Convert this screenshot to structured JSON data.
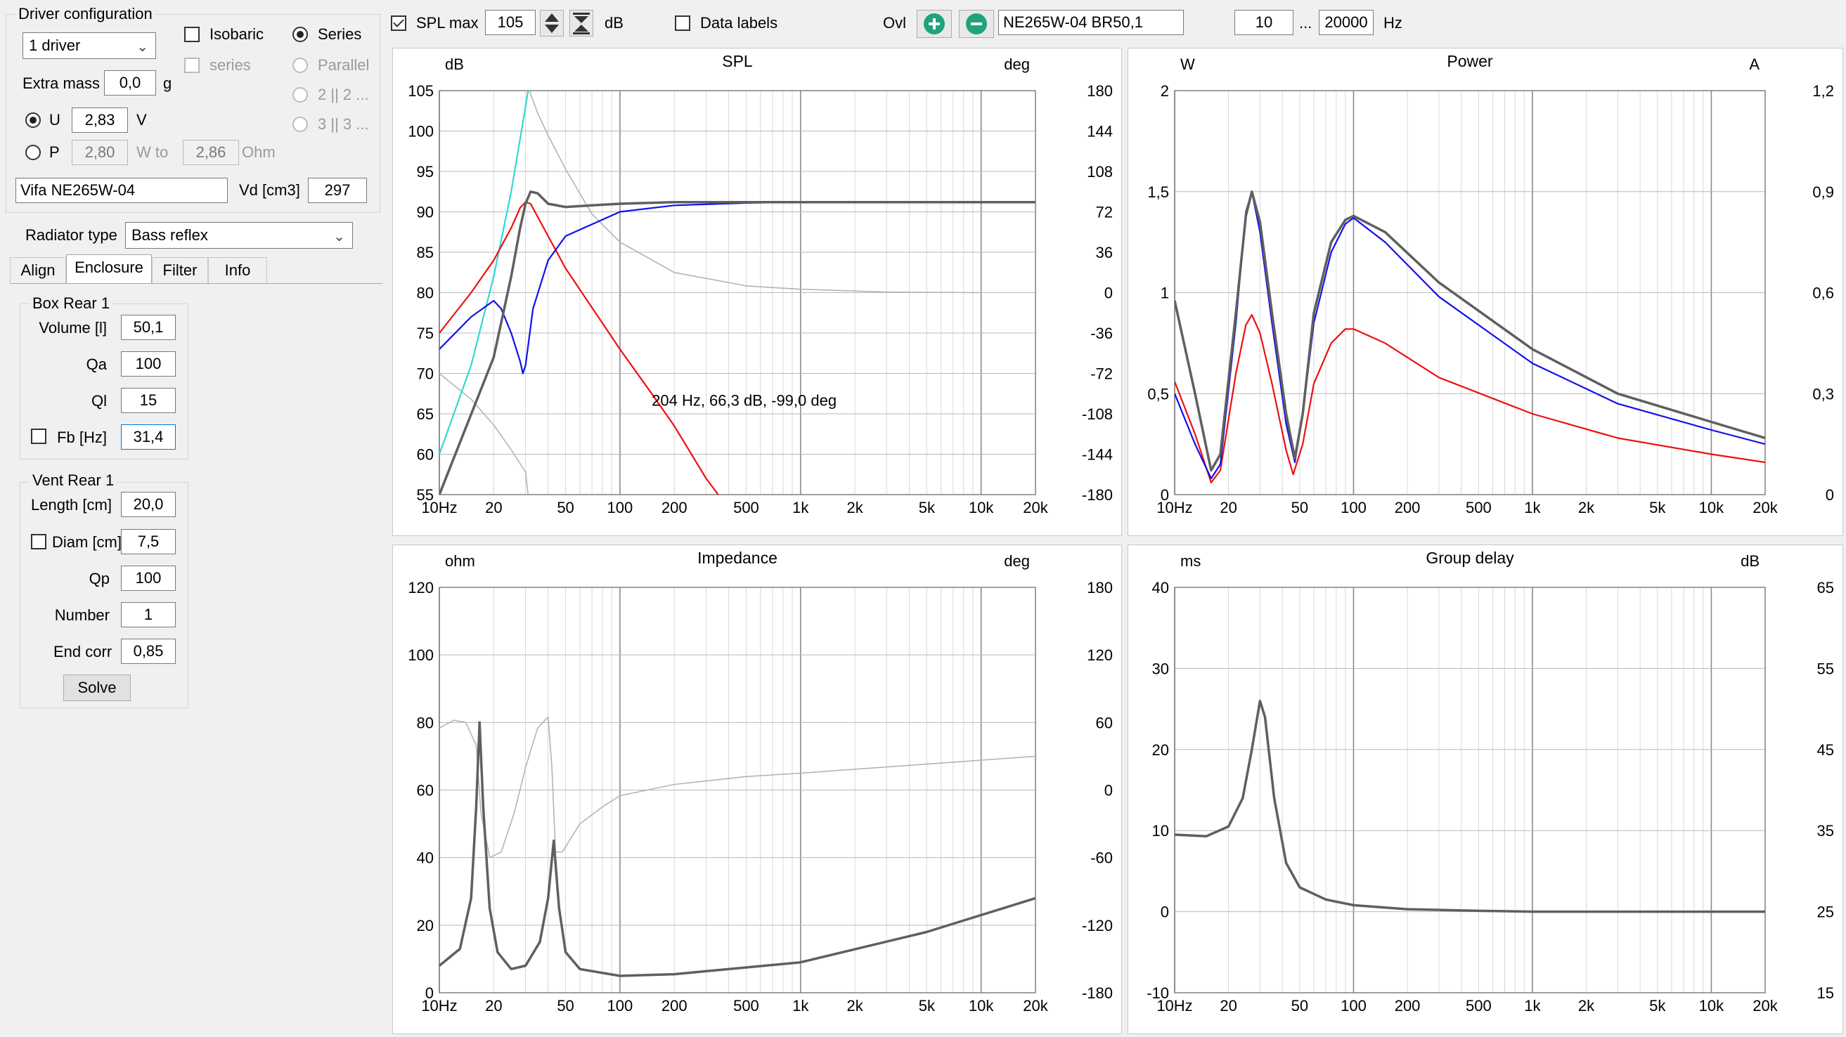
{
  "driver_config": {
    "group_title": "Driver configuration",
    "driver_count": "1 driver",
    "isobaric_label": "Isobaric",
    "isobaric_checked": false,
    "series_sub_label": "series",
    "wiring_options": [
      "Series",
      "Parallel",
      "2 || 2 ...",
      "3 || 3 ..."
    ],
    "wiring_selected": "Series",
    "extra_mass_label": "Extra mass",
    "extra_mass_value": "0,0",
    "extra_mass_unit": "g",
    "u_label": "U",
    "u_value": "2,83",
    "u_unit": "V",
    "p_label": "P",
    "p_value": "2,80",
    "p_unit": "W to",
    "ohm_value": "2,86",
    "ohm_unit": "Ohm",
    "driver_name": "Vifa NE265W-04",
    "vd_label": "Vd [cm3]",
    "vd_value": "297"
  },
  "radiator": {
    "label": "Radiator type",
    "value": "Bass reflex"
  },
  "tabs": [
    "Align",
    "Enclosure",
    "Filter",
    "Info"
  ],
  "active_tab": "Enclosure",
  "box": {
    "title": "Box Rear 1",
    "volume_label": "Volume [l]",
    "volume": "50,1",
    "qa_label": "Qa",
    "qa": "100",
    "ql_label": "Ql",
    "ql": "15",
    "fb_label": "Fb [Hz]",
    "fb": "31,4",
    "fb_checked": false
  },
  "vent": {
    "title": "Vent Rear 1",
    "length_label": "Length [cm]",
    "length": "20,0",
    "diam_label": "Diam [cm]",
    "diam": "7,5",
    "diam_checked": false,
    "qp_label": "Qp",
    "qp": "100",
    "number_label": "Number",
    "number": "1",
    "endcorr_label": "End corr",
    "endcorr": "0,85",
    "solve_label": "Solve"
  },
  "toolbar": {
    "spl_max_label": "SPL max",
    "spl_max_checked": true,
    "spl_max_value": "105",
    "db_unit": "dB",
    "data_labels_label": "Data labels",
    "data_labels_checked": false,
    "ovl_label": "Ovl",
    "overlay_name": "NE265W-04 BR50,1",
    "freq_min": "10",
    "ellipsis": "...",
    "freq_max": "20000",
    "hz_unit": "Hz"
  },
  "colors": {
    "gray_total": "#5f5f5f",
    "blue": "#1010ee",
    "red": "#ee1010",
    "cyan": "#30d8d8",
    "light_gray": "#b4b4b4"
  },
  "chart_data": [
    {
      "type": "line",
      "title": "SPL",
      "left_unit": "dB",
      "right_unit": "deg",
      "x_scale": "log",
      "xlim": [
        10,
        20000
      ],
      "ylim": [
        55,
        105
      ],
      "y2lim": [
        -180,
        180
      ],
      "x_ticks": [
        "10Hz",
        "20",
        "50",
        "100",
        "200",
        "500",
        "1k",
        "2k",
        "5k",
        "10k",
        "20k"
      ],
      "y_ticks": [
        "105",
        "100",
        "95",
        "90",
        "85",
        "80",
        "75",
        "70",
        "65",
        "60",
        "55"
      ],
      "y2_ticks": [
        "180",
        "144",
        "108",
        "72",
        "36",
        "0",
        "-36",
        "-72",
        "-108",
        "-144",
        "-180"
      ],
      "annotation": "204 Hz, 66,3 dB, -99,0 deg",
      "series": [
        {
          "color": "gray_total",
          "axis": "left",
          "points": [
            [
              10,
              55
            ],
            [
              20,
              72
            ],
            [
              25,
              82
            ],
            [
              28,
              88
            ],
            [
              30,
              91
            ],
            [
              32,
              92.5
            ],
            [
              35,
              92.3
            ],
            [
              40,
              91
            ],
            [
              50,
              90.6
            ],
            [
              70,
              90.8
            ],
            [
              100,
              91
            ],
            [
              200,
              91.2
            ],
            [
              1000,
              91.2
            ],
            [
              20000,
              91.2
            ]
          ]
        },
        {
          "color": "blue",
          "axis": "left",
          "points": [
            [
              10,
              73
            ],
            [
              15,
              77
            ],
            [
              20,
              79
            ],
            [
              22,
              78
            ],
            [
              25,
              75
            ],
            [
              28,
              71.5
            ],
            [
              29,
              70
            ],
            [
              30,
              71
            ],
            [
              33,
              78
            ],
            [
              40,
              84
            ],
            [
              50,
              87
            ],
            [
              100,
              90
            ],
            [
              200,
              90.8
            ],
            [
              500,
              91.1
            ],
            [
              1000,
              91.2
            ],
            [
              20000,
              91.2
            ]
          ]
        },
        {
          "color": "red",
          "axis": "left",
          "points": [
            [
              10,
              75
            ],
            [
              15,
              80
            ],
            [
              20,
              84
            ],
            [
              25,
              88
            ],
            [
              28,
              90.5
            ],
            [
              30,
              91.2
            ],
            [
              32,
              91
            ],
            [
              40,
              87
            ],
            [
              50,
              83
            ],
            [
              100,
              73
            ],
            [
              150,
              67.5
            ],
            [
              200,
              63.5
            ],
            [
              300,
              57
            ],
            [
              350,
              55
            ]
          ]
        },
        {
          "color": "cyan",
          "axis": "left",
          "points": [
            [
              10,
              60
            ],
            [
              15,
              71
            ],
            [
              20,
              82
            ],
            [
              25,
              92.5
            ],
            [
              30,
              103
            ],
            [
              31,
              105
            ]
          ]
        },
        {
          "color": "light_gray",
          "axis": "right",
          "points": [
            [
              10,
              -72
            ],
            [
              15,
              -95
            ],
            [
              20,
              -118
            ],
            [
              25,
              -140
            ],
            [
              30,
              -160
            ],
            [
              31,
              -180
            ],
            [
              31.5,
              180
            ],
            [
              35,
              160
            ],
            [
              40,
              140
            ],
            [
              50,
              110
            ],
            [
              70,
              70
            ],
            [
              100,
              45
            ],
            [
              200,
              18
            ],
            [
              500,
              6
            ],
            [
              1000,
              3
            ],
            [
              3000,
              0.5
            ],
            [
              10000,
              0
            ]
          ]
        }
      ]
    },
    {
      "type": "line",
      "title": "Power",
      "left_unit": "W",
      "right_unit": "A",
      "x_scale": "log",
      "xlim": [
        10,
        20000
      ],
      "ylim": [
        0,
        2
      ],
      "y2lim": [
        0,
        1.2
      ],
      "x_ticks": [
        "10Hz",
        "20",
        "50",
        "100",
        "200",
        "500",
        "1k",
        "2k",
        "5k",
        "10k",
        "20k"
      ],
      "y_ticks": [
        "2",
        "1,5",
        "1",
        "0,5",
        "0"
      ],
      "y2_ticks": [
        "1,2",
        "0,9",
        "0,6",
        "0,3",
        "0"
      ],
      "series": [
        {
          "color": "gray_total",
          "points": [
            [
              10,
              0.96
            ],
            [
              13,
              0.5
            ],
            [
              16,
              0.12
            ],
            [
              18,
              0.2
            ],
            [
              22,
              0.9
            ],
            [
              25,
              1.38
            ],
            [
              27,
              1.5
            ],
            [
              30,
              1.35
            ],
            [
              35,
              0.9
            ],
            [
              42,
              0.4
            ],
            [
              47,
              0.18
            ],
            [
              52,
              0.4
            ],
            [
              60,
              0.9
            ],
            [
              75,
              1.25
            ],
            [
              90,
              1.36
            ],
            [
              100,
              1.38
            ],
            [
              150,
              1.3
            ],
            [
              300,
              1.05
            ],
            [
              1000,
              0.72
            ],
            [
              3000,
              0.5
            ],
            [
              10000,
              0.36
            ],
            [
              20000,
              0.28
            ]
          ]
        },
        {
          "color": "blue",
          "points": [
            [
              10,
              0.5
            ],
            [
              13,
              0.25
            ],
            [
              16,
              0.08
            ],
            [
              18,
              0.15
            ],
            [
              22,
              0.85
            ],
            [
              25,
              1.4
            ],
            [
              27,
              1.5
            ],
            [
              30,
              1.3
            ],
            [
              35,
              0.85
            ],
            [
              42,
              0.35
            ],
            [
              47,
              0.16
            ],
            [
              52,
              0.4
            ],
            [
              60,
              0.85
            ],
            [
              75,
              1.2
            ],
            [
              90,
              1.34
            ],
            [
              100,
              1.37
            ],
            [
              150,
              1.25
            ],
            [
              300,
              0.98
            ],
            [
              1000,
              0.65
            ],
            [
              3000,
              0.45
            ],
            [
              10000,
              0.32
            ],
            [
              20000,
              0.25
            ]
          ]
        },
        {
          "color": "red",
          "points": [
            [
              10,
              0.56
            ],
            [
              13,
              0.3
            ],
            [
              16,
              0.06
            ],
            [
              18,
              0.12
            ],
            [
              22,
              0.6
            ],
            [
              25,
              0.84
            ],
            [
              27,
              0.89
            ],
            [
              30,
              0.8
            ],
            [
              35,
              0.55
            ],
            [
              42,
              0.22
            ],
            [
              46,
              0.1
            ],
            [
              52,
              0.25
            ],
            [
              60,
              0.55
            ],
            [
              75,
              0.75
            ],
            [
              90,
              0.82
            ],
            [
              100,
              0.82
            ],
            [
              150,
              0.75
            ],
            [
              300,
              0.58
            ],
            [
              1000,
              0.4
            ],
            [
              3000,
              0.28
            ],
            [
              10000,
              0.2
            ],
            [
              20000,
              0.16
            ]
          ]
        }
      ]
    },
    {
      "type": "line",
      "title": "Impedance",
      "left_unit": "ohm",
      "right_unit": "deg",
      "x_scale": "log",
      "xlim": [
        10,
        20000
      ],
      "ylim": [
        0,
        120
      ],
      "y2lim": [
        -180,
        180
      ],
      "x_ticks": [
        "10Hz",
        "20",
        "50",
        "100",
        "200",
        "500",
        "1k",
        "2k",
        "5k",
        "10k",
        "20k"
      ],
      "y_ticks": [
        "120",
        "100",
        "80",
        "60",
        "40",
        "20",
        "0"
      ],
      "y2_ticks": [
        "180",
        "120",
        "60",
        "0",
        "-60",
        "-120",
        "-180"
      ],
      "series": [
        {
          "color": "gray_total",
          "axis": "left",
          "points": [
            [
              10,
              8
            ],
            [
              13,
              13
            ],
            [
              15,
              28
            ],
            [
              16,
              55
            ],
            [
              16.7,
              80
            ],
            [
              17.5,
              55
            ],
            [
              19,
              25
            ],
            [
              21,
              12
            ],
            [
              25,
              7
            ],
            [
              30,
              8
            ],
            [
              36,
              15
            ],
            [
              40,
              28
            ],
            [
              43,
              45
            ],
            [
              46,
              25
            ],
            [
              50,
              12
            ],
            [
              60,
              7
            ],
            [
              100,
              5
            ],
            [
              200,
              5.5
            ],
            [
              1000,
              9
            ],
            [
              5000,
              18
            ],
            [
              20000,
              28
            ]
          ]
        },
        {
          "color": "light_gray",
          "axis": "right",
          "points": [
            [
              10,
              55
            ],
            [
              12,
              62
            ],
            [
              14,
              60
            ],
            [
              16,
              40
            ],
            [
              17,
              -20
            ],
            [
              19,
              -60
            ],
            [
              22,
              -55
            ],
            [
              26,
              -20
            ],
            [
              30,
              20
            ],
            [
              35,
              55
            ],
            [
              40,
              65
            ],
            [
              42,
              20
            ],
            [
              44,
              -55
            ],
            [
              48,
              -55
            ],
            [
              60,
              -30
            ],
            [
              80,
              -15
            ],
            [
              100,
              -5
            ],
            [
              200,
              5
            ],
            [
              500,
              12
            ],
            [
              1000,
              15
            ],
            [
              20000,
              30
            ]
          ]
        }
      ]
    },
    {
      "type": "line",
      "title": "Group delay",
      "left_unit": "ms",
      "right_unit": "dB",
      "x_scale": "log",
      "xlim": [
        10,
        20000
      ],
      "ylim": [
        -10,
        40
      ],
      "y2lim": [
        15,
        65
      ],
      "x_ticks": [
        "10Hz",
        "20",
        "50",
        "100",
        "200",
        "500",
        "1k",
        "2k",
        "5k",
        "10k",
        "20k"
      ],
      "y_ticks": [
        "40",
        "30",
        "20",
        "10",
        "0",
        "-10"
      ],
      "y2_ticks": [
        "65",
        "55",
        "45",
        "35",
        "25",
        "15"
      ],
      "series": [
        {
          "color": "gray_total",
          "points": [
            [
              10,
              9.5
            ],
            [
              15,
              9.3
            ],
            [
              20,
              10.5
            ],
            [
              24,
              14
            ],
            [
              27,
              20
            ],
            [
              30,
              26
            ],
            [
              32,
              24
            ],
            [
              36,
              14
            ],
            [
              42,
              6
            ],
            [
              50,
              3
            ],
            [
              70,
              1.5
            ],
            [
              100,
              0.8
            ],
            [
              200,
              0.3
            ],
            [
              500,
              0.1
            ],
            [
              1000,
              0
            ],
            [
              20000,
              0
            ]
          ]
        }
      ]
    }
  ]
}
